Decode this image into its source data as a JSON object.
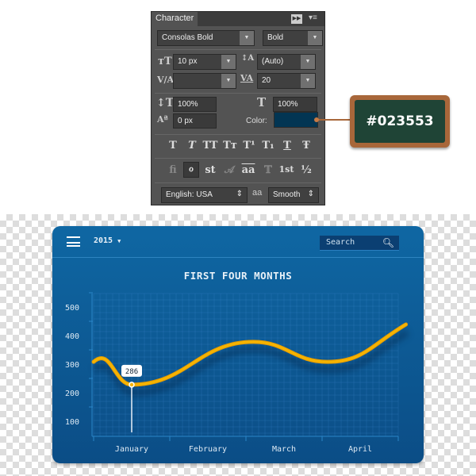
{
  "panel": {
    "tab": "Character",
    "font_family": "Consolas Bold",
    "font_style": "Bold",
    "font_size": "10 px",
    "leading": "(Auto)",
    "kerning": "",
    "tracking": "20",
    "vertical_scale": "100%",
    "horizontal_scale": "100%",
    "baseline_shift": "0 px",
    "color_label": "Color:",
    "color_value": "#023553",
    "style_buttons": [
      "T",
      "T",
      "TT",
      "Tт",
      "T¹",
      "T₁",
      "T",
      "Ŧ"
    ],
    "opentype_buttons": [
      "fi",
      "ℴ",
      "st",
      "𝒜",
      "aa",
      "𝕋",
      "1st",
      "½"
    ],
    "language": "English: USA",
    "aa_icon": "aa",
    "antialias": "Smooth"
  },
  "swatch_label": "#023553",
  "widget": {
    "year": "2015",
    "search_placeholder": "Search",
    "title": "FIRST FOUR MONTHS",
    "tooltip": "286",
    "colors": {
      "line": "#f5b400",
      "card": "#0d5a96"
    }
  },
  "chart_data": {
    "type": "line",
    "title": "FIRST FOUR MONTHS",
    "categories": [
      "January",
      "February",
      "March",
      "April"
    ],
    "yticks": [
      100,
      200,
      300,
      400,
      500
    ],
    "ylim": [
      40,
      540
    ],
    "grid": true,
    "points": [
      [
        0,
        308
      ],
      [
        0.5,
        228
      ],
      [
        2.1,
        378
      ],
      [
        3.07,
        308
      ],
      [
        4.1,
        439
      ]
    ],
    "highlight": {
      "category": "January",
      "label": "286"
    }
  }
}
